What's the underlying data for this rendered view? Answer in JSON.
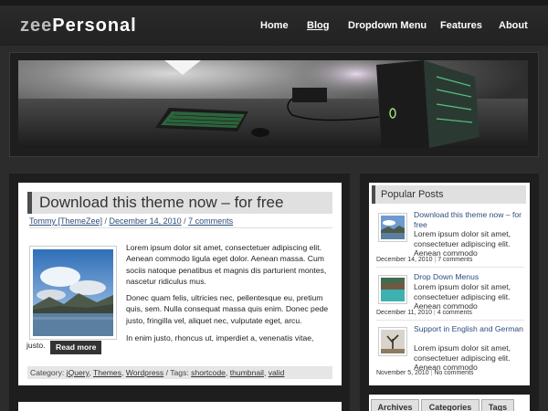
{
  "header": {
    "logo_part1": "zee",
    "logo_part2": "Personal",
    "nav": [
      "Home",
      "Blog",
      "Dropdown Menu",
      "Features",
      "About"
    ],
    "active_nav": "Blog"
  },
  "post": {
    "title": "Download this theme now – for free",
    "author": "Tommy [ThemeZee]",
    "date": "December 14, 2010",
    "comments": "7 comments",
    "paragraphs": [
      "Lorem ipsum dolor sit amet, consectetuer adipiscing elit. Aenean commodo ligula eget dolor. Aenean massa. Cum sociis natoque penatibus et magnis dis parturient montes, nascetur ridiculus mus.",
      "Donec quam felis, ultricies nec, pellentesque eu, pretium quis, sem. Nulla consequat massa quis enim. Donec pede justo, fringilla vel, aliquet nec, vulputate eget, arcu.",
      "In enim justo, rhoncus ut, imperdiet a, venenatis vitae,"
    ],
    "last_word": "justo.",
    "read_more": "Read more",
    "category_label": "Category:",
    "categories": [
      "jQuery",
      "Themes",
      "Wordpress"
    ],
    "tags_label": "Tags:",
    "tags": [
      "shortcode",
      "thumbnail",
      "valid"
    ]
  },
  "sidebar": {
    "title": "Popular Posts",
    "posts": [
      {
        "title": "Download this theme now – for free",
        "excerpt": "Lorem ipsum dolor sit amet, consectetuer adipiscing elit. Aenean commodo",
        "date": "December 14, 2010",
        "comments": "7 comments"
      },
      {
        "title": "Drop Down Menus",
        "excerpt": "Lorem ipsum dolor sit amet, consectetuer adipiscing elit. Aenean commodo",
        "date": "December 11, 2010",
        "comments": "4 comments"
      },
      {
        "title": "Support in English and German",
        "excerpt": "Lorem ipsum dolor sit amet, consectetuer adipiscing elit. Aenean commodo",
        "date": "November 5, 2010",
        "comments": "No comments"
      }
    ],
    "tabs": [
      "Archives",
      "Categories",
      "Tags"
    ]
  },
  "colors": {
    "background": "#2c2c2c",
    "link": "#2b4e7c",
    "title_bar": "#e0e0e0",
    "accent_dark": "#4d4d4d"
  }
}
